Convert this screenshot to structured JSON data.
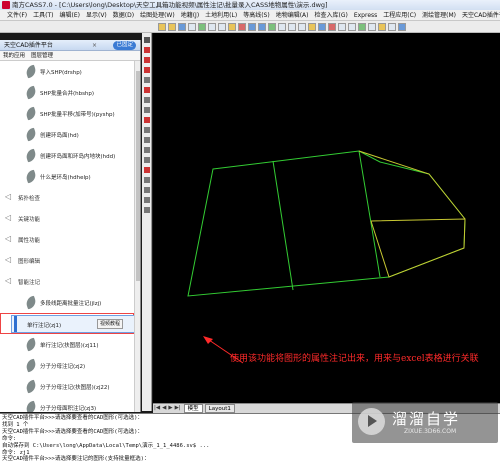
{
  "window": {
    "title": "南方CASS7.0 - [C:\\Users\\long\\Desktop\\天空工具箱功能视频\\属性注记\\批量录入CASS地物属性\\演示.dwg]"
  },
  "menubar": {
    "items": [
      "文件(F)",
      "工具(T)",
      "编辑(E)",
      "显示(V)",
      "数据(D)",
      "绘图处理(W)",
      "地籍(J)",
      "土地利用(L)",
      "等高线(S)",
      "地物编辑(A)",
      "检查入库(G)",
      "Express",
      "工程应用(C)",
      "测绘管理(M)",
      "天空CAD插件平台"
    ]
  },
  "panel": {
    "title": "天空CAD插件平台",
    "close": "×",
    "pin_label": "已固定",
    "tabs": [
      "我的应用",
      "图层管理"
    ],
    "items": [
      {
        "type": "item",
        "label": "导入SHP(drshp)"
      },
      {
        "type": "item",
        "label": "SHP批量合并(hbshp)"
      },
      {
        "type": "item",
        "label": "SHP批量平移(加带号)(pyshp)"
      },
      {
        "type": "item",
        "label": "创建环岛面(hd)"
      },
      {
        "type": "item",
        "label": "创建环岛面和环岛内地块(hdd)"
      },
      {
        "type": "item",
        "label": "什么是环岛(hdhelp)"
      },
      {
        "type": "category",
        "label": "拓扑检查"
      },
      {
        "type": "category",
        "label": "关键功能"
      },
      {
        "type": "category",
        "label": "属性功能"
      },
      {
        "type": "category",
        "label": "图形编辑"
      },
      {
        "type": "category",
        "label": "智能注记"
      },
      {
        "type": "item",
        "label": "多段线距离批量注记(jlzj)"
      },
      {
        "type": "selected",
        "label": "单行注记(zj1)",
        "video": "视频教程"
      },
      {
        "type": "item",
        "label": "单行注记(扶图层)(zj11)"
      },
      {
        "type": "item",
        "label": "分子分母注记(zj2)"
      },
      {
        "type": "item",
        "label": "分子分母注记(扶图层)(zj22)"
      },
      {
        "type": "item",
        "label": "分子分母面积注记(zj3)"
      },
      {
        "type": "item",
        "label": "分子分母面积注记(扶图层)(zj33)"
      },
      {
        "type": "category",
        "label": "其他"
      }
    ]
  },
  "layout_tabs": {
    "nav": [
      "|◀",
      "◀",
      "▶",
      "▶|"
    ],
    "tabs": [
      "模型",
      "Layout1"
    ]
  },
  "annotation": "使用该功能将图形的属性注记出来，用来与excel表格进行关联",
  "command_lines": [
    "天空CAD插件平台>>>请选择要查看的CAD图形(可选选)：",
    "找到 1 个",
    "天空CAD插件平台>>>请选择要查看的CAD图形(可选选)：",
    "命令:",
    "自动保存到 C:\\Users\\long\\AppData\\Local\\Temp\\演示_1_1_4486.sv$ ...",
    "命令: zj1",
    "天空CAD插件平台>>>请选择要注记的图形(支持批量框选)："
  ],
  "watermark": {
    "name": "溜溜自学",
    "url": "ZIXUE.3D66.COM"
  },
  "colors": {
    "polygon_green": "#33cc33",
    "polygon_yellow": "#c8c832",
    "annotation_red": "#ff2a2a",
    "selection_border": "#ee4444"
  }
}
